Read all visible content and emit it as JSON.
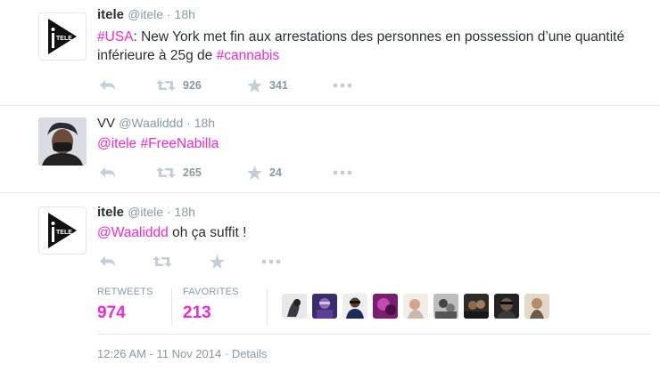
{
  "tweets": [
    {
      "name": "itele",
      "handle": "@itele",
      "time": "18h",
      "text_parts": [
        {
          "t": "#USA",
          "hl": true
        },
        {
          "t": ": New York met fin aux arrestations des personnes en possession d’une quantité inférieure à 25g de ",
          "hl": false
        },
        {
          "t": "#cannabis",
          "hl": true
        }
      ],
      "retweets": "926",
      "favorites": "341"
    },
    {
      "name": "VV",
      "handle": "@Waaliddd",
      "time": "18h",
      "text_parts": [
        {
          "t": "@itele",
          "hl": true
        },
        {
          "t": " ",
          "hl": false
        },
        {
          "t": "#FreeNabilla",
          "hl": true
        }
      ],
      "retweets": "265",
      "favorites": "24"
    },
    {
      "name": "itele",
      "handle": "@itele",
      "time": "18h",
      "text_parts": [
        {
          "t": "@Waaliddd",
          "hl": true
        },
        {
          "t": " oh ça suffit !",
          "hl": false
        }
      ],
      "retweets": "",
      "favorites": ""
    }
  ],
  "detail": {
    "retweets_label": "RETWEETS",
    "retweets_value": "974",
    "favorites_label": "FAVORITES",
    "favorites_value": "213",
    "timestamp": "12:26 AM - 11 Nov 2014",
    "details_link": "Details"
  },
  "meta_sep": " · ",
  "colors": {
    "accent": "#ea2bd0",
    "meta_gray": "#8899a6",
    "icon_gray": "#c5ced6",
    "divider": "#e1e8ed"
  },
  "icons": [
    "reply-icon",
    "retweet-icon",
    "favorite-star-icon",
    "more-icon"
  ],
  "faved_by_count": 9
}
